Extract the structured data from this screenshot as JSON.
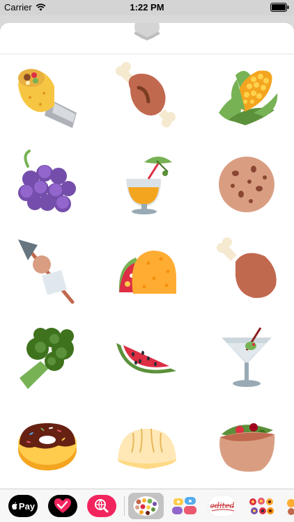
{
  "status_bar": {
    "carrier": "Carrier",
    "time": "1:22 PM"
  },
  "sticker_pack": {
    "stickers": [
      "burrito",
      "meat-on-bone",
      "ear-of-corn",
      "grapes",
      "tropical-drink",
      "cookie",
      "oden",
      "taco",
      "poultry-leg",
      "broccoli",
      "watermelon",
      "cocktail-glass",
      "doughnut",
      "dumpling",
      "stuffed-flatbread"
    ]
  },
  "app_strip": {
    "apple_pay_label": "Pay",
    "edited_label": "edited",
    "apps": [
      "apple-pay",
      "heart-app",
      "search-app",
      "food-stickers",
      "message-stickers",
      "edited-stickers",
      "flower-stickers",
      "more-stickers"
    ]
  },
  "colors": {
    "sheet": "#ffffff",
    "backdrop": "#d9d9d9",
    "accent_pink": "#f2245e"
  }
}
